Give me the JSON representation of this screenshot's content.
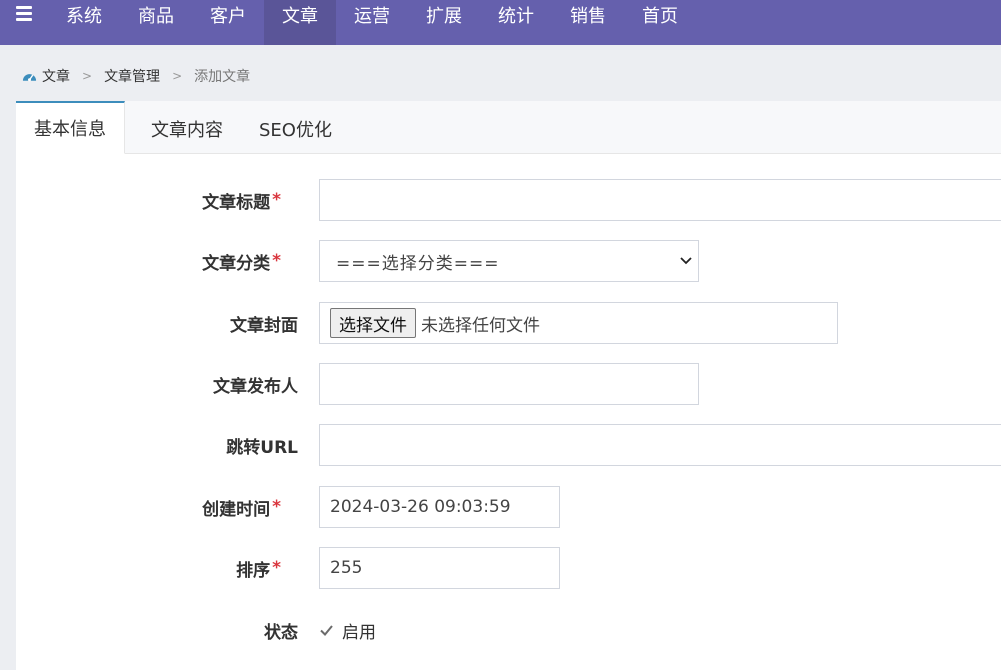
{
  "nav": {
    "items": [
      {
        "label": "系统"
      },
      {
        "label": "商品"
      },
      {
        "label": "客户"
      },
      {
        "label": "文章"
      },
      {
        "label": "运营"
      },
      {
        "label": "扩展"
      },
      {
        "label": "统计"
      },
      {
        "label": "销售"
      },
      {
        "label": "首页"
      }
    ],
    "active_index": 3,
    "bar_color": "#6560ad",
    "active_color": "#5a5598"
  },
  "breadcrumb": {
    "items": [
      "文章",
      "文章管理",
      "添加文章"
    ],
    "separator": ">"
  },
  "tabs": [
    {
      "label": "基本信息",
      "active": true
    },
    {
      "label": "文章内容",
      "active": false
    },
    {
      "label": "SEO优化",
      "active": false
    }
  ],
  "form": {
    "title": {
      "label": "文章标题",
      "required": "*",
      "value": ""
    },
    "category": {
      "label": "文章分类",
      "required": "*",
      "selected": "===选择分类==="
    },
    "cover": {
      "label": "文章封面",
      "button": "选择文件",
      "status": "未选择任何文件"
    },
    "author": {
      "label": "文章发布人",
      "value": ""
    },
    "url": {
      "label": "跳转URL",
      "value": ""
    },
    "created": {
      "label": "创建时间",
      "required": "*",
      "value": "2024-03-26 09:03:59"
    },
    "sort": {
      "label": "排序",
      "required": "*",
      "value": "255"
    },
    "status": {
      "label": "状态",
      "option": "启用",
      "checked": true
    }
  },
  "colors": {
    "required": "#d9363e",
    "tab_accent": "#3c8dbc"
  }
}
